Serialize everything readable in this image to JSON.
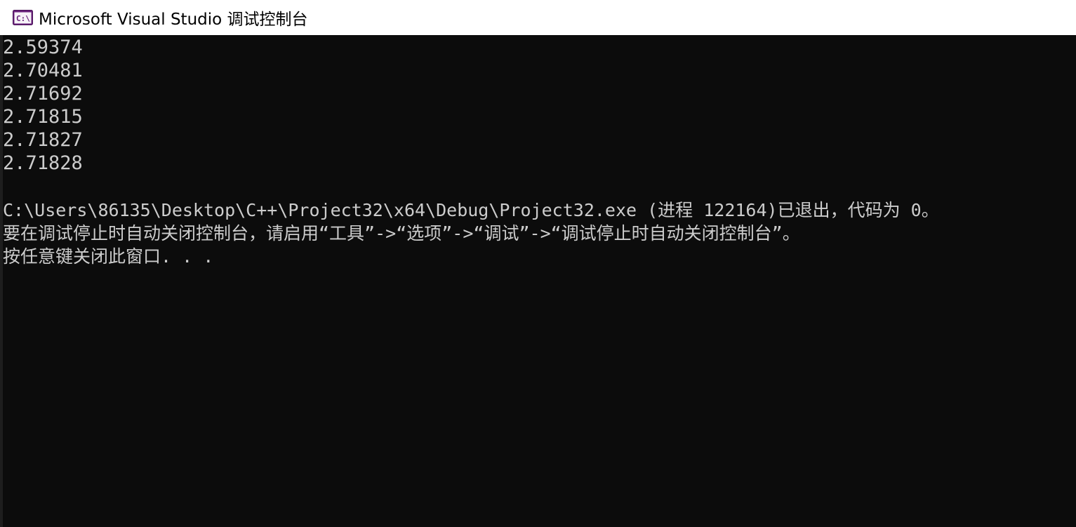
{
  "window": {
    "title": "Microsoft Visual Studio 调试控制台",
    "icon": "console-app-icon",
    "colors": {
      "titlebar_bg": "#ffffff",
      "console_bg": "#0c0c0c",
      "console_text": "#cccccc",
      "icon_accent": "#68217a"
    }
  },
  "console": {
    "values": [
      "2.59374",
      "2.70481",
      "2.71692",
      "2.71815",
      "2.71827",
      "2.71828"
    ],
    "exit_message": "C:\\Users\\86135\\Desktop\\C++\\Project32\\x64\\Debug\\Project32.exe (进程 122164)已退出，代码为 0。",
    "auto_close_hint": "要在调试停止时自动关闭控制台，请启用“工具”->“选项”->“调试”->“调试停止时自动关闭控制台”。",
    "press_any_key": "按任意键关闭此窗口. . ."
  }
}
